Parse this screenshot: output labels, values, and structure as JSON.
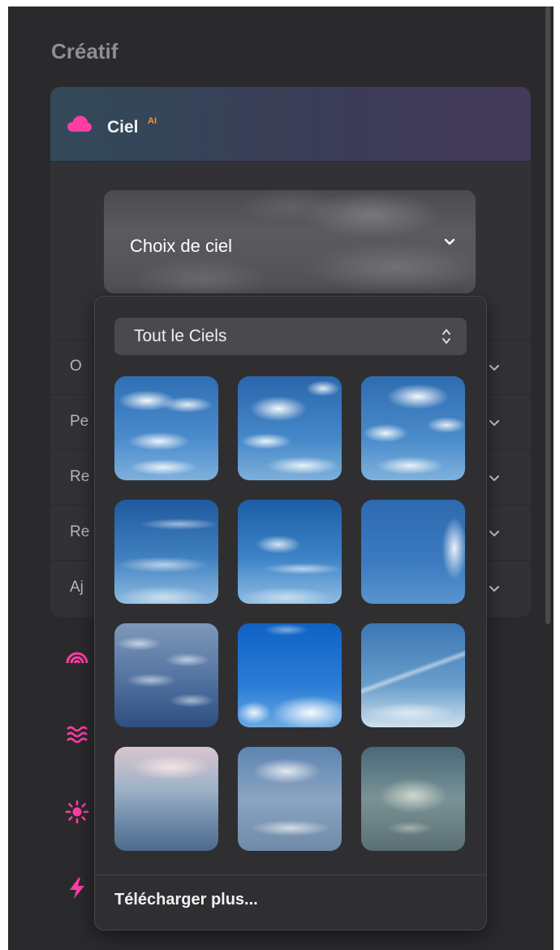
{
  "section": {
    "title": "Créatif"
  },
  "panel": {
    "title": "Ciel",
    "badge": "AI",
    "sky_select": {
      "label": "Choix de ciel"
    },
    "rows": [
      {
        "label": "O"
      },
      {
        "label": "Pe"
      },
      {
        "label": "Re"
      },
      {
        "label": "Re"
      },
      {
        "label": "Aj"
      }
    ]
  },
  "toolbar_icons": [
    "rainbow-icon",
    "waves-icon",
    "sun-icon",
    "lightning-icon"
  ],
  "dropdown": {
    "filter_value": "Tout le Ciels",
    "thumbnails": [
      {
        "name": "sky-thumb-1",
        "style": "cumulus-blue"
      },
      {
        "name": "sky-thumb-2",
        "style": "cumulus-blue"
      },
      {
        "name": "sky-thumb-3",
        "style": "cumulus-blue"
      },
      {
        "name": "sky-thumb-4",
        "style": "wispy-blue"
      },
      {
        "name": "sky-thumb-5",
        "style": "wispy-blue"
      },
      {
        "name": "sky-thumb-6",
        "style": "clear-blue"
      },
      {
        "name": "sky-thumb-7",
        "style": "altocumulus"
      },
      {
        "name": "sky-thumb-8",
        "style": "bright-cumulus"
      },
      {
        "name": "sky-thumb-9",
        "style": "contrails"
      },
      {
        "name": "sky-thumb-10",
        "style": "pastel-haze"
      },
      {
        "name": "sky-thumb-11",
        "style": "stratus"
      },
      {
        "name": "sky-thumb-12",
        "style": "storm-teal"
      }
    ],
    "more_label": "Télécharger plus..."
  },
  "colors": {
    "accent": "#ff3ea5",
    "ai_badge": "#f59a23",
    "background": "#2a2a2d",
    "panel": "#323236"
  }
}
